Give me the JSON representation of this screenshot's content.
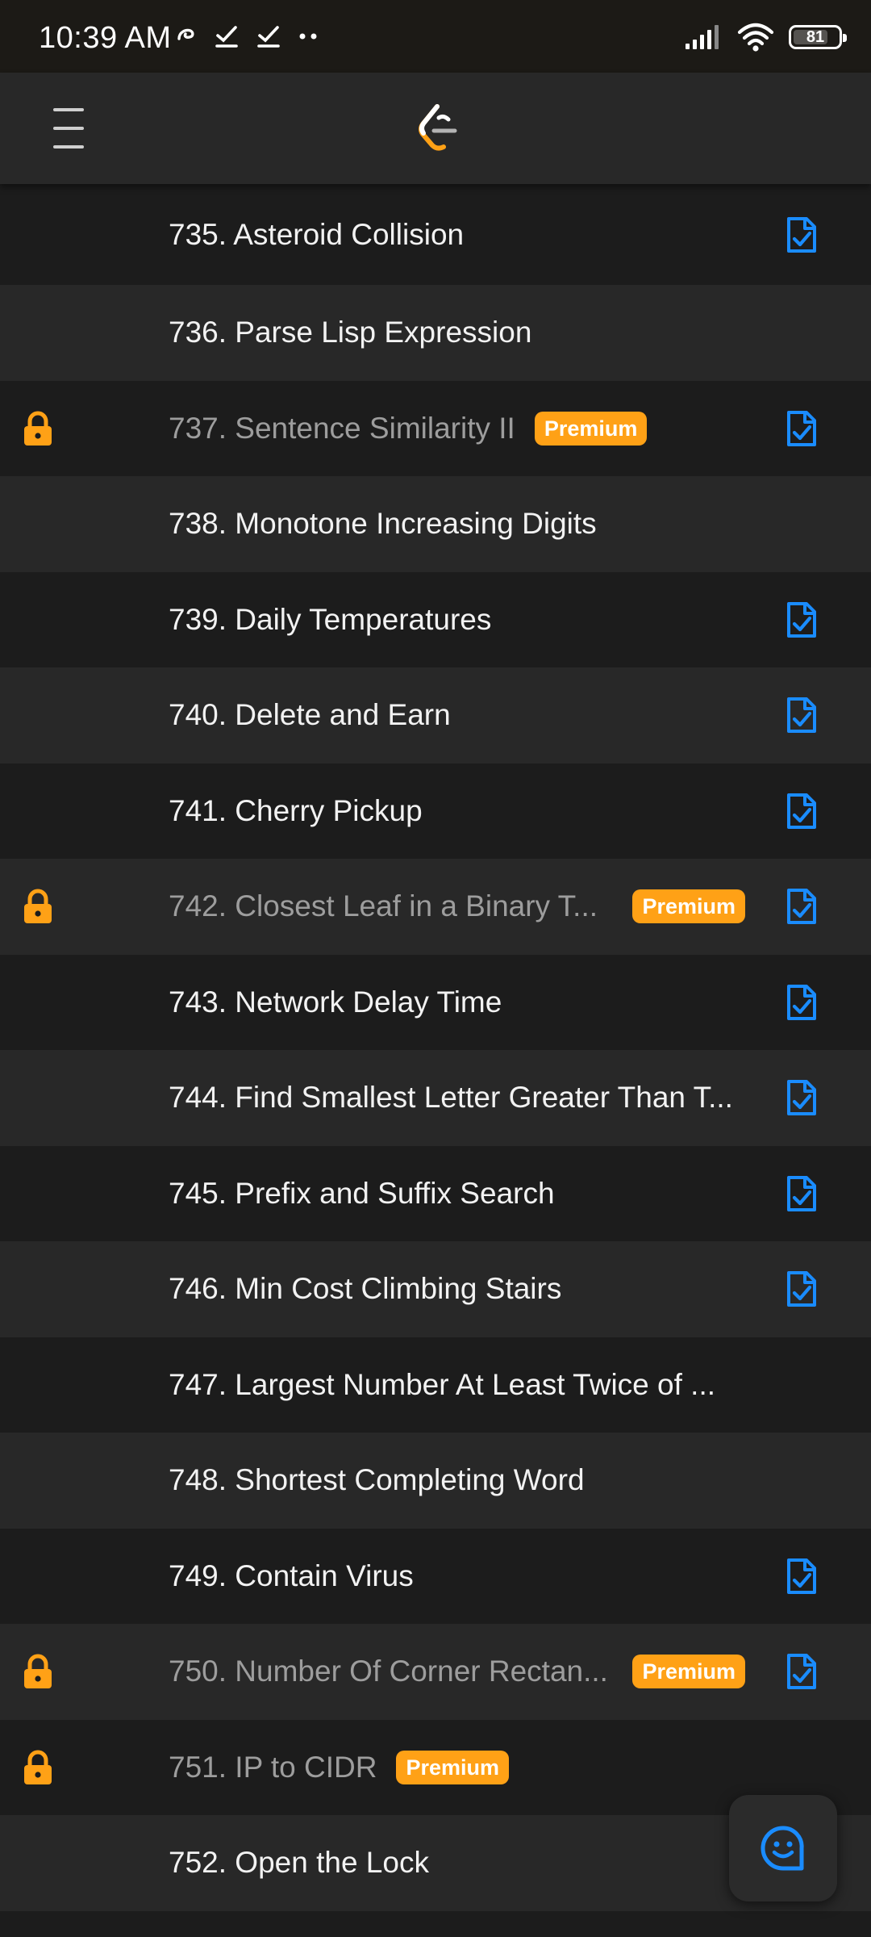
{
  "status_bar": {
    "time": "10:39 AM",
    "battery": "81"
  },
  "colors": {
    "accent_orange": "#ffa116",
    "solved_blue": "#1a8cff",
    "row_dark": "#1c1c1c",
    "row_light": "#282828"
  },
  "problems": [
    {
      "title": "735. Asteroid Collision",
      "premium": false,
      "solved": true
    },
    {
      "title": "736. Parse Lisp Expression",
      "premium": false,
      "solved": false
    },
    {
      "title": "737. Sentence Similarity II",
      "premium": true,
      "solved": true
    },
    {
      "title": "738. Monotone Increasing Digits",
      "premium": false,
      "solved": false
    },
    {
      "title": "739. Daily Temperatures",
      "premium": false,
      "solved": true
    },
    {
      "title": "740. Delete and Earn",
      "premium": false,
      "solved": true
    },
    {
      "title": "741. Cherry Pickup",
      "premium": false,
      "solved": true
    },
    {
      "title": "742. Closest Leaf in a Binary T...",
      "premium": true,
      "solved": true
    },
    {
      "title": "743. Network Delay Time",
      "premium": false,
      "solved": true
    },
    {
      "title": "744. Find Smallest Letter Greater Than T...",
      "premium": false,
      "solved": true
    },
    {
      "title": "745. Prefix and Suffix Search",
      "premium": false,
      "solved": true
    },
    {
      "title": "746. Min Cost Climbing Stairs",
      "premium": false,
      "solved": true
    },
    {
      "title": "747. Largest Number At Least Twice of ...",
      "premium": false,
      "solved": false
    },
    {
      "title": "748. Shortest Completing Word",
      "premium": false,
      "solved": false
    },
    {
      "title": "749. Contain Virus",
      "premium": false,
      "solved": true
    },
    {
      "title": "750. Number Of Corner Rectan...",
      "premium": true,
      "solved": true
    },
    {
      "title": "751. IP to CIDR",
      "premium": true,
      "solved": false
    },
    {
      "title": "752. Open the Lock",
      "premium": false,
      "solved": false
    }
  ],
  "premium_label": "Premium"
}
